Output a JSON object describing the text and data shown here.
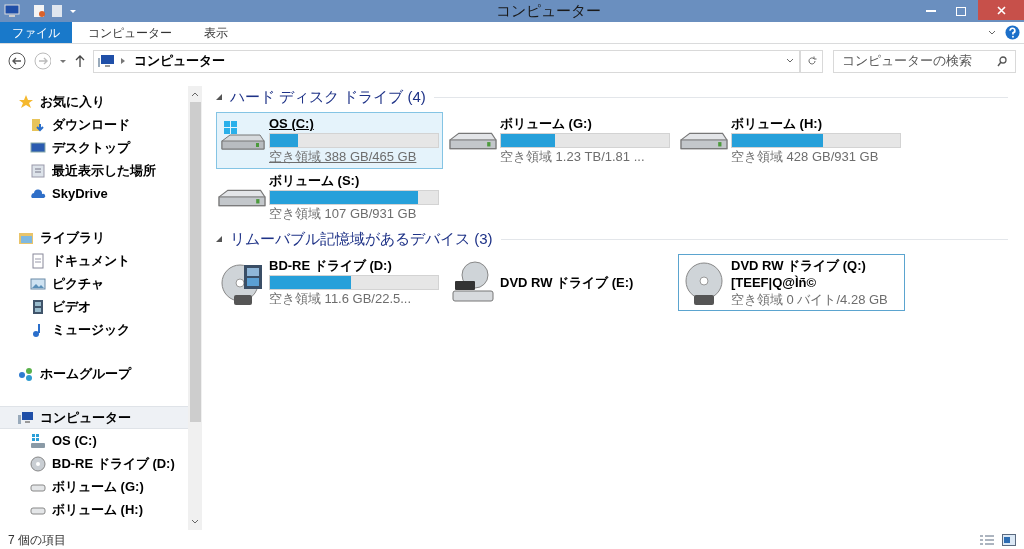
{
  "window": {
    "title": "コンピューター"
  },
  "ribbon_tabs": [
    {
      "label": "ファイル",
      "selected": true
    },
    {
      "label": "コンピューター",
      "selected": false
    },
    {
      "label": "表示",
      "selected": false
    }
  ],
  "address_bar": {
    "path": "コンピューター"
  },
  "search": {
    "placeholder": "コンピューターの検索"
  },
  "sidebar": {
    "groups": [
      {
        "label": "お気に入り",
        "kind": "star",
        "selected": false,
        "children": [
          {
            "label": "ダウンロード",
            "kind": "download",
            "selected": false
          },
          {
            "label": "デスクトップ",
            "kind": "desktop",
            "selected": false
          },
          {
            "label": "最近表示した場所",
            "kind": "recent",
            "selected": false
          },
          {
            "label": "SkyDrive",
            "kind": "cloud",
            "selected": false
          }
        ]
      },
      {
        "label": "ライブラリ",
        "kind": "library",
        "selected": false,
        "children": [
          {
            "label": "ドキュメント",
            "kind": "document",
            "selected": false
          },
          {
            "label": "ピクチャ",
            "kind": "picture",
            "selected": false
          },
          {
            "label": "ビデオ",
            "kind": "video",
            "selected": false
          },
          {
            "label": "ミュージック",
            "kind": "music",
            "selected": false
          }
        ]
      },
      {
        "label": "ホームグループ",
        "kind": "homegroup",
        "selected": false
      },
      {
        "label": "コンピューター",
        "kind": "computer",
        "selected": true,
        "children": [
          {
            "label": "OS (C:)",
            "kind": "os",
            "selected": false
          },
          {
            "label": "BD-RE ドライブ (D:)",
            "kind": "disc",
            "selected": false
          },
          {
            "label": "ボリューム (G:)",
            "kind": "hdd",
            "selected": false
          },
          {
            "label": "ボリューム (H:)",
            "kind": "hdd",
            "selected": false
          }
        ]
      }
    ]
  },
  "groups": [
    {
      "title": "ハード ディスク ドライブ (4)",
      "drives": [
        {
          "name": "OS (C:)",
          "kind": "os",
          "level": 0.165,
          "free": "空き領域 388 GB/465 GB",
          "selected": true,
          "focused": false
        },
        {
          "name": "ボリューム (G:)",
          "kind": "hdd",
          "level": 0.32,
          "free": "空き領域 1.23 TB/1.81 ...",
          "selected": false,
          "focused": false
        },
        {
          "name": "ボリューム (H:)",
          "kind": "hdd",
          "level": 0.54,
          "free": "空き領域 428 GB/931 GB",
          "selected": false,
          "focused": false
        },
        {
          "name": "ボリューム (S:)",
          "kind": "hdd",
          "level": 0.88,
          "free": "空き領域 107 GB/931 GB",
          "selected": false,
          "focused": false
        }
      ]
    },
    {
      "title": "リムーバブル記憶域があるデバイス (3)",
      "drives": [
        {
          "name": "BD-RE ドライブ (D:)",
          "kind": "bd",
          "level": 0.48,
          "free": "空き領域 11.6 GB/22.5...",
          "selected": false,
          "focused": false
        },
        {
          "name": "DVD RW ドライブ (E:)",
          "kind": "dvd-drive",
          "selected": false,
          "focused": false
        },
        {
          "name": "DVD RW ドライブ (Q:)",
          "kind": "dvd",
          "label": "[TEEF|Q@Ìñ©",
          "free": "空き領域 0 バイト/4.28 GB",
          "selected": false,
          "focused": true
        }
      ]
    }
  ],
  "status_bar": {
    "text": "7 個の項目"
  }
}
